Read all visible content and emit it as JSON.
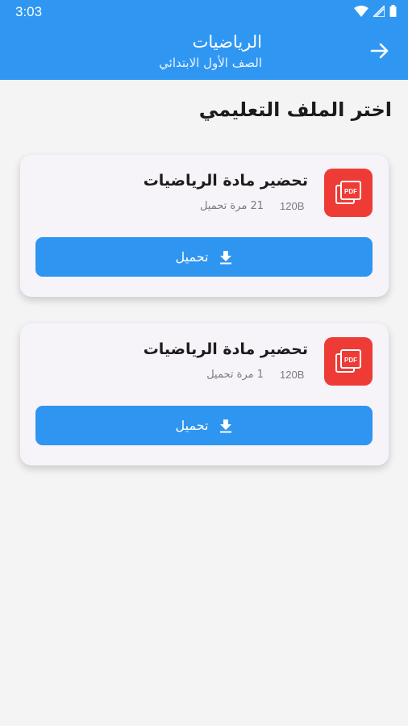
{
  "status_bar": {
    "time": "3:03",
    "icons": [
      "wifi-icon",
      "signal-icon",
      "battery-icon"
    ]
  },
  "header": {
    "title": "الرياضيات",
    "subtitle": "الصف الأول الابتدائي",
    "back_icon": "arrow-right-icon",
    "background_color": "#2f97f2"
  },
  "main": {
    "heading": "اختر الملف التعليمي",
    "files": [
      {
        "title": "تحضير مادة الرياضيات",
        "size": "120B",
        "downloads": "21 مرة تحميل",
        "icon": "pdf-icon",
        "action_label": "تحميل",
        "action_icon": "download-icon"
      },
      {
        "title": "تحضير مادة الرياضيات",
        "size": "120B",
        "downloads": "1 مرة تحميل",
        "icon": "pdf-icon",
        "action_label": "تحميل",
        "action_icon": "download-icon"
      }
    ]
  },
  "colors": {
    "accent": "#2e95f0",
    "pdf_tile": "#ef3b36",
    "card_bg": "#f6f3f9"
  }
}
